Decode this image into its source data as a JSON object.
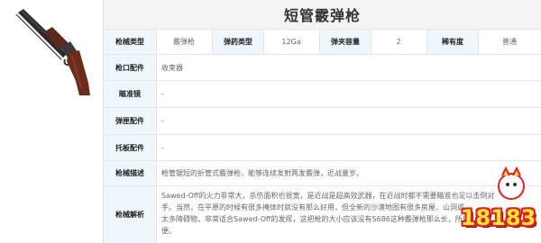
{
  "title": "短管霰弹枪",
  "specs": {
    "type_label": "枪械类型",
    "type_value": "霰弹枪",
    "ammo_label": "弹药类型",
    "ammo_value": "12Ga",
    "capacity_label": "弹夹容量",
    "capacity_value": "2",
    "rarity_label": "稀有度",
    "rarity_value": "普通"
  },
  "rows": {
    "muzzle": {
      "label": "枪口配件",
      "value": "收束器"
    },
    "scope": {
      "label": "瞄准镜",
      "value": "-"
    },
    "grip": {
      "label": "弹匣配件",
      "value": "-"
    },
    "stock": {
      "label": "托板配件",
      "value": "-"
    },
    "description": {
      "label": "枪械描述",
      "value": "枪管锯短的折管式霰弹枪，能够连续发射两发霰弹，近战量岁。"
    },
    "analysis": {
      "label": "枪械解析",
      "line1": "Sawed-Off的火力非常大，杀伤面积也很宽，是近战是超高效武器，在近战时都不需要瞄准也足以击倒对",
      "line2": "手。当然，在平原的时候有很多掩体时就没有那么好用，但全新的沙漠地图有很多房屋、山洞或",
      "line3": "太多障碍物，非常适合Sawed-Off的发挥，这把枪的大小应该没有S686这种霰弹枪那么长，所以",
      "line4": "便。"
    }
  },
  "watermark": {
    "text": "18183"
  },
  "colors": {
    "label_bg": "#eef7fc",
    "title_bg": "#f4f4f4",
    "border": "#e3e7ea",
    "logo_yellow": "#ffe23a",
    "logo_red": "#d22222"
  }
}
